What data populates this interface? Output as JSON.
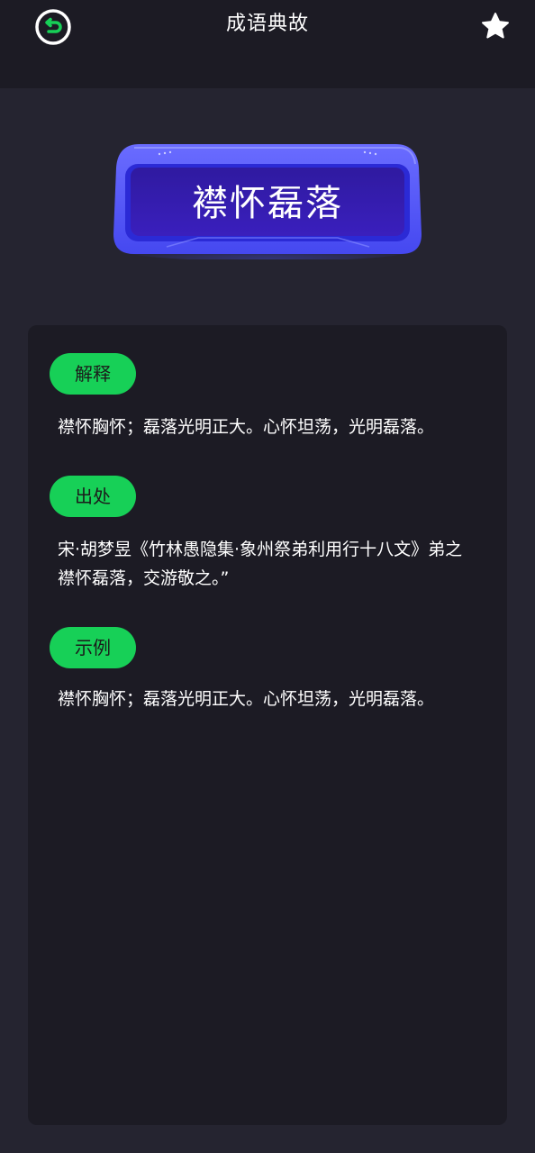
{
  "header": {
    "title": "成语典故",
    "back_icon": "back-icon",
    "favorite_icon": "star-icon"
  },
  "idiom": {
    "text": "襟怀磊落"
  },
  "sections": [
    {
      "label": "解释",
      "text": "襟怀胸怀；磊落光明正大。心怀坦荡，光明磊落。"
    },
    {
      "label": "出处",
      "text": "宋·胡梦昱《竹林愚隐集·象州祭弟利用行十八文》弟之\n襟怀磊落，交游敬之。”"
    },
    {
      "label": "示例",
      "text": "襟怀胸怀；磊落光明正大。心怀坦荡，光明磊落。"
    }
  ],
  "colors": {
    "accent": "#17d057",
    "background": "#252430",
    "card": "#1c1b24",
    "plaque": "#3b34c8"
  }
}
